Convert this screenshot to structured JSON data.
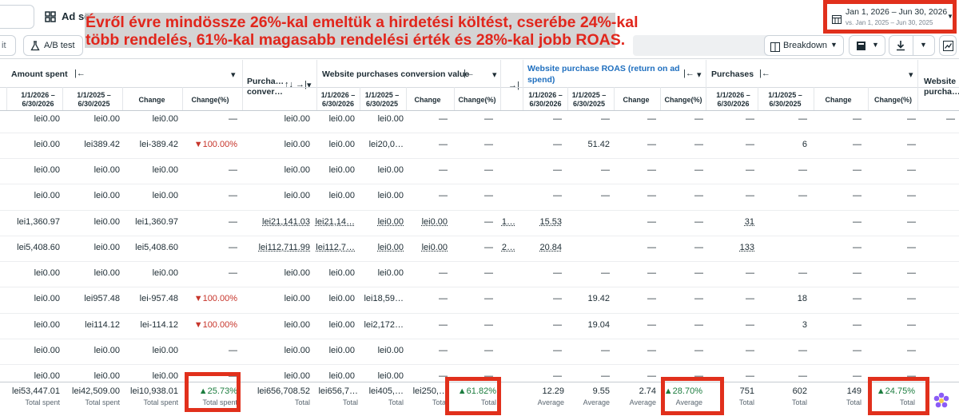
{
  "toolbar": {
    "tab_partial": "Ad se",
    "left_partial": "it",
    "ab_test": "A/B test",
    "breakdown": "Breakdown",
    "date_range": "Jan 1, 2026 – Jun 30, 2026",
    "compare_range": "vs. Jan 1, 2025 – Jun 30, 2025"
  },
  "overlay": {
    "line1": "Évről évre mindössze 26%-kal emeltük a hirdetési költést, cserébe 24%-kal",
    "line2": "több rendelés, 61%-kal magasabb rendelési érték és 28%-kal jobb ROAS."
  },
  "headers": {
    "amount_spent": "Amount spent",
    "purchase_conv_1": "Purcha…",
    "purchase_conv_2": "conver…",
    "wp_conv_value": "Website purchases conversion value",
    "roas_1": "Website purchase ROAS (return on ad",
    "roas_2": "spend)",
    "purchases": "Purchases",
    "website_purch_1": "Website",
    "website_purch_2": "purcha…",
    "period_a_1": "1/1/2026 –",
    "period_a_2": "6/30/2026",
    "period_b_1": "1/1/2025 –",
    "period_b_2": "6/30/2025",
    "change": "Change",
    "change_pct": "Change(%)"
  },
  "rows": [
    [
      "lei0.00",
      "lei0.00",
      "lei0.00",
      "—",
      "lei0.00",
      "lei0.00",
      "lei0.00",
      "—",
      "—",
      "",
      "—",
      "—",
      "—",
      "—",
      "—",
      "—",
      "—",
      "—",
      "—"
    ],
    [
      "lei0.00",
      "lei389.42",
      "lei-389.42",
      "▼100.00%",
      "lei0.00",
      "lei0.00",
      "lei20,0…",
      "—",
      "—",
      "",
      "—",
      "51.42",
      "—",
      "—",
      "—",
      "6",
      "—",
      "—",
      ""
    ],
    [
      "lei0.00",
      "lei0.00",
      "lei0.00",
      "—",
      "lei0.00",
      "lei0.00",
      "lei0.00",
      "—",
      "—",
      "",
      "—",
      "—",
      "—",
      "—",
      "—",
      "—",
      "—",
      "—",
      ""
    ],
    [
      "lei0.00",
      "lei0.00",
      "lei0.00",
      "—",
      "lei0.00",
      "lei0.00",
      "lei0.00",
      "—",
      "—",
      "",
      "—",
      "—",
      "—",
      "—",
      "—",
      "—",
      "—",
      "—",
      ""
    ],
    [
      "lei1,360.97",
      "lei0.00",
      "lei1,360.97",
      "—",
      "lei21,141.03",
      "lei21,14…",
      "lei0.00",
      "lei0.00",
      "—",
      "1…",
      "15.53",
      "",
      "—",
      "—",
      "31",
      "",
      "—",
      "—",
      ""
    ],
    [
      "lei5,408.60",
      "lei0.00",
      "lei5,408.60",
      "—",
      "lei112,711.99",
      "lei112,7…",
      "lei0.00",
      "lei0.00",
      "—",
      "2…",
      "20.84",
      "",
      "—",
      "—",
      "133",
      "",
      "—",
      "—",
      ""
    ],
    [
      "lei0.00",
      "lei0.00",
      "lei0.00",
      "—",
      "lei0.00",
      "lei0.00",
      "lei0.00",
      "—",
      "—",
      "",
      "—",
      "—",
      "—",
      "—",
      "—",
      "—",
      "—",
      "—",
      ""
    ],
    [
      "lei0.00",
      "lei957.48",
      "lei-957.48",
      "▼100.00%",
      "lei0.00",
      "lei0.00",
      "lei18,59…",
      "—",
      "—",
      "",
      "—",
      "19.42",
      "—",
      "—",
      "—",
      "18",
      "—",
      "—",
      ""
    ],
    [
      "lei0.00",
      "lei114.12",
      "lei-114.12",
      "▼100.00%",
      "lei0.00",
      "lei0.00",
      "lei2,172…",
      "—",
      "—",
      "",
      "—",
      "19.04",
      "—",
      "—",
      "—",
      "3",
      "—",
      "—",
      ""
    ],
    [
      "lei0.00",
      "lei0.00",
      "lei0.00",
      "—",
      "lei0.00",
      "lei0.00",
      "lei0.00",
      "—",
      "—",
      "",
      "—",
      "—",
      "—",
      "—",
      "—",
      "—",
      "—",
      "—",
      ""
    ],
    [
      "lei0.00",
      "lei0.00",
      "lei0.00",
      "—",
      "lei0.00",
      "lei0.00",
      "lei0.00",
      "—",
      "—",
      "",
      "—",
      "—",
      "—",
      "—",
      "—",
      "—",
      "—",
      "—",
      ""
    ]
  ],
  "totals": {
    "values": [
      "lei53,447.01",
      "lei42,509.00",
      "lei10,938.01",
      "▲25.73%",
      "lei656,708.52",
      "lei656,7…",
      "lei405,…",
      "lei250,…",
      "▲61.82%",
      "12.29",
      "9.55",
      "2.74",
      "▲28.70%",
      "751",
      "602",
      "149",
      "▲24.75%"
    ],
    "labels": [
      "Total spent",
      "Total spent",
      "Total spent",
      "Total spent",
      "Total",
      "Total",
      "Total",
      "Total",
      "Total",
      "Average",
      "Average",
      "Average",
      "Average",
      "Total",
      "Total",
      "Total",
      "Total"
    ]
  }
}
